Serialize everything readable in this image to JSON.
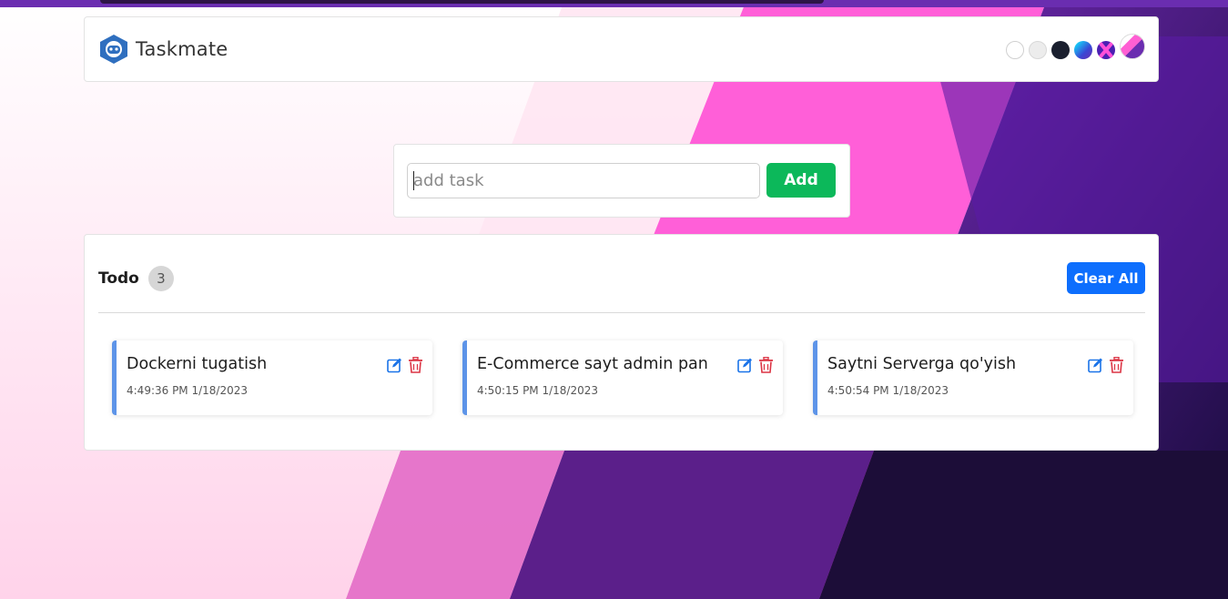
{
  "app": {
    "name": "Taskmate",
    "icon": "robot-logo-icon"
  },
  "theme": {
    "swatches": [
      {
        "name": "white-theme-swatch",
        "color": "#ffffff"
      },
      {
        "name": "light-gray-theme-swatch",
        "color": "#ececec"
      },
      {
        "name": "dark-theme-swatch",
        "color": "#1a1f2e"
      },
      {
        "name": "blue-gradient-theme-swatch",
        "color": "#3a47d5"
      },
      {
        "name": "purple-pattern-theme-swatch",
        "color": "#4b1fb3"
      },
      {
        "name": "pink-gradient-theme-swatch",
        "color": "#ff5fd3"
      }
    ]
  },
  "add_task": {
    "placeholder": "add task",
    "value": "",
    "button_label": "Add"
  },
  "todo": {
    "title": "Todo",
    "count": "3",
    "clear_label": "Clear All",
    "tasks": [
      {
        "title": "Dockerni tugatish",
        "time": "4:49:36 PM 1/18/2023"
      },
      {
        "title": "E-Commerce sayt admin pan",
        "time": "4:50:15 PM 1/18/2023"
      },
      {
        "title": "Saytni Serverga qo'yish",
        "time": "4:50:54 PM 1/18/2023"
      }
    ]
  },
  "colors": {
    "accent": "#5d94e8",
    "add_button": "#0cb85a",
    "clear_button": "#0d6efd",
    "edit_icon": "#1a73e8",
    "delete_icon": "#dc3545"
  }
}
